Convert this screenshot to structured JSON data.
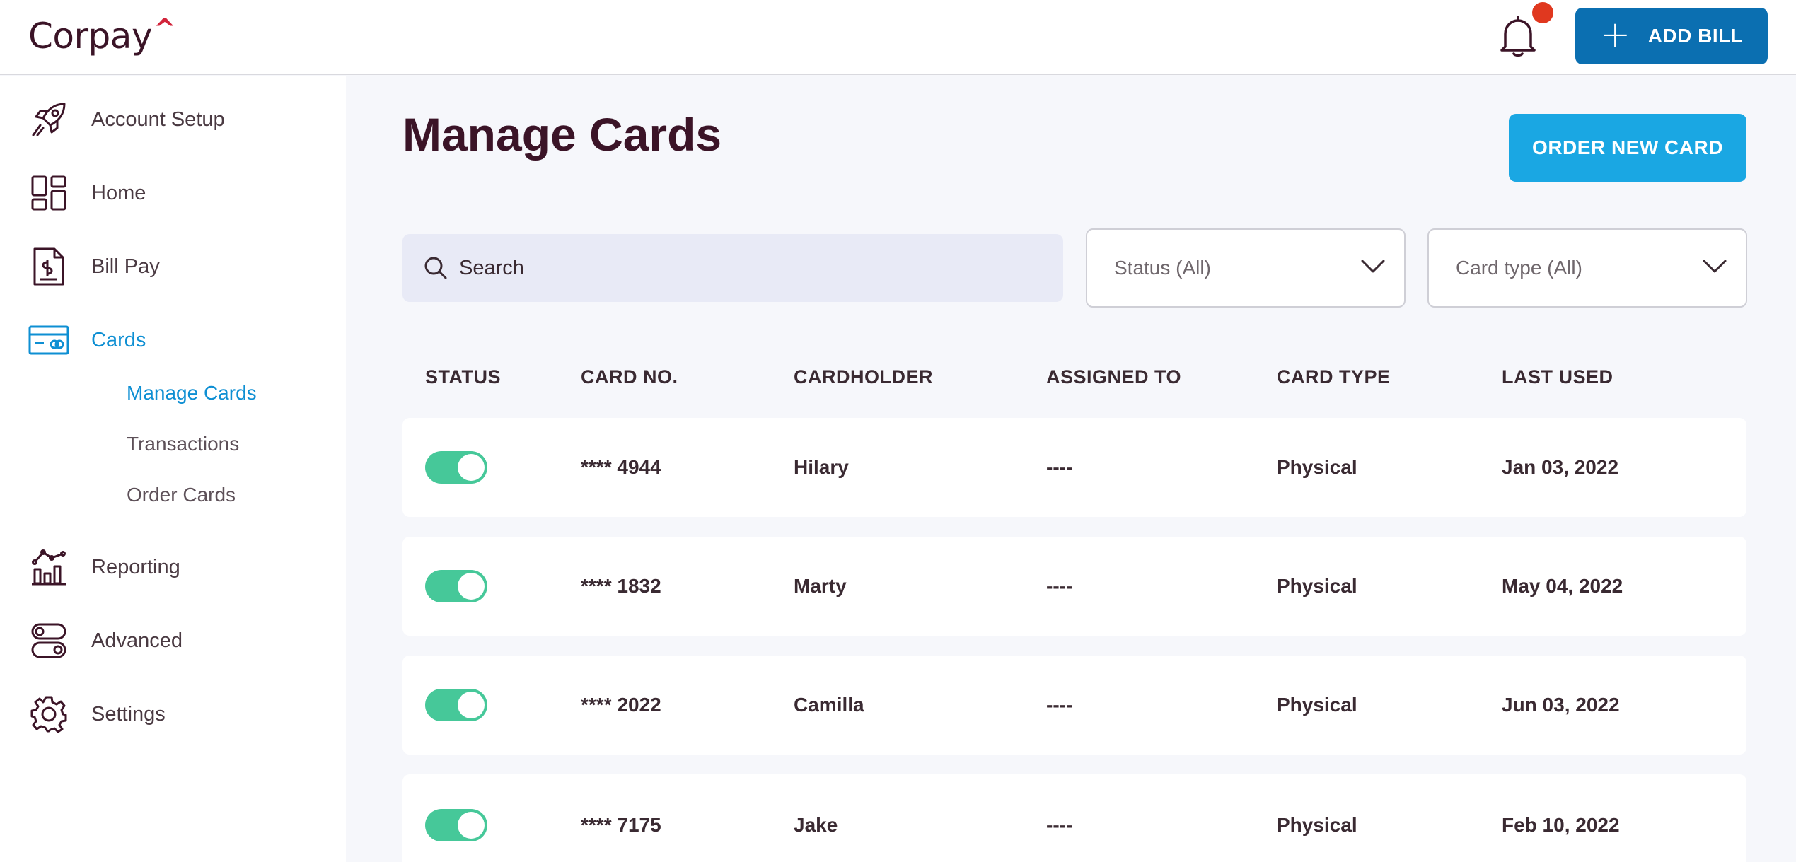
{
  "header": {
    "logo_text": "Corpay",
    "logo_mark": "^",
    "add_bill_label": "ADD BILL",
    "add_bill_icon": "plus-icon",
    "notification_icon": "bell-icon",
    "accent_color": "#0b6fb1"
  },
  "sidebar": {
    "items": [
      {
        "label": "Account Setup",
        "icon": "rocket-icon"
      },
      {
        "label": "Home",
        "icon": "dashboard-icon"
      },
      {
        "label": "Bill Pay",
        "icon": "invoice-icon"
      },
      {
        "label": "Cards",
        "icon": "credit-card-icon"
      },
      {
        "label": "Reporting",
        "icon": "chart-icon"
      },
      {
        "label": "Advanced",
        "icon": "toggles-icon"
      },
      {
        "label": "Settings",
        "icon": "gear-icon"
      }
    ],
    "sub_items": [
      {
        "label": "Manage Cards"
      },
      {
        "label": "Transactions"
      },
      {
        "label": "Order Cards"
      }
    ],
    "active_color": "#0e8fd3"
  },
  "main": {
    "title": "Manage Cards",
    "order_button_label": "ORDER NEW CARD",
    "search_placeholder": "Search",
    "status_filter": "Status (All)",
    "card_type_filter": "Card type (All)",
    "columns": [
      "STATUS",
      "CARD NO.",
      "CARDHOLDER",
      "ASSIGNED TO",
      "CARD TYPE",
      "LAST USED"
    ],
    "rows": [
      {
        "status": "on",
        "card_no": "**** 4944",
        "cardholder": "Hilary",
        "assigned_to": "----",
        "card_type": "Physical",
        "last_used": "Jan 03, 2022"
      },
      {
        "status": "on",
        "card_no": "**** 1832",
        "cardholder": "Marty",
        "assigned_to": "----",
        "card_type": "Physical",
        "last_used": "May 04, 2022"
      },
      {
        "status": "on",
        "card_no": "**** 2022",
        "cardholder": "Camilla",
        "assigned_to": "----",
        "card_type": "Physical",
        "last_used": "Jun 03, 2022"
      },
      {
        "status": "on",
        "card_no": "**** 7175",
        "cardholder": "Jake",
        "assigned_to": "----",
        "card_type": "Physical",
        "last_used": "Feb 10, 2022"
      }
    ],
    "toggle_color": "#46c899"
  }
}
